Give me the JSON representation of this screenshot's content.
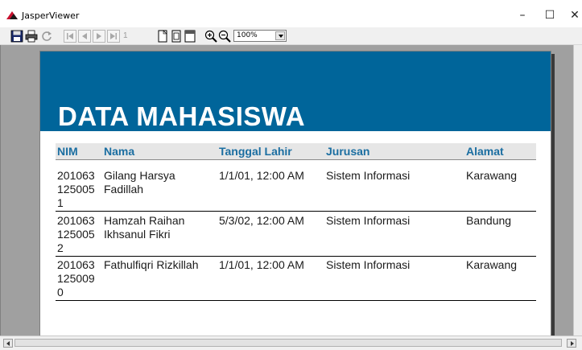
{
  "window": {
    "title": "JasperViewer",
    "minimize_symbol": "–",
    "maximize_symbol": "☐",
    "close_symbol": "✕"
  },
  "toolbar": {
    "save_icon": "save-icon",
    "print_icon": "print-icon",
    "reload_icon": "reload-icon",
    "first_icon": "first-page-icon",
    "previous_icon": "previous-page-icon",
    "next_icon": "next-page-icon",
    "last_icon": "last-page-icon",
    "page_number": "1",
    "actual_size_icon": "actual-size-icon",
    "fit_page_icon": "fit-page-icon",
    "fit_width_icon": "fit-width-icon",
    "zoom_in_icon": "zoom-in-icon",
    "zoom_out_icon": "zoom-out-icon",
    "zoom_value": "100%"
  },
  "report": {
    "title": "DATA MAHASISWA",
    "header_color": "#00659a",
    "columns": [
      "NIM",
      "Nama",
      "Tanggal Lahir",
      "Jurusan",
      "Alamat"
    ],
    "rows": [
      {
        "nim_lines": [
          "201063",
          "125005",
          "1"
        ],
        "nama_lines": [
          "Gilang Harsya",
          "Fadillah"
        ],
        "tanggal_lahir": "1/1/01, 12:00 AM",
        "jurusan": "Sistem Informasi",
        "alamat": "Karawang"
      },
      {
        "nim_lines": [
          "201063",
          "125005",
          "2"
        ],
        "nama_lines": [
          "Hamzah Raihan",
          "Ikhsanul Fikri"
        ],
        "tanggal_lahir": "5/3/02, 12:00 AM",
        "jurusan": "Sistem Informasi",
        "alamat": "Bandung"
      },
      {
        "nim_lines": [
          "201063",
          "125009",
          "0"
        ],
        "nama_lines": [
          "Fathulfiqri Rizkillah"
        ],
        "tanggal_lahir": "1/1/01, 12:00 AM",
        "jurusan": "Sistem Informasi",
        "alamat": "Karawang"
      }
    ]
  }
}
